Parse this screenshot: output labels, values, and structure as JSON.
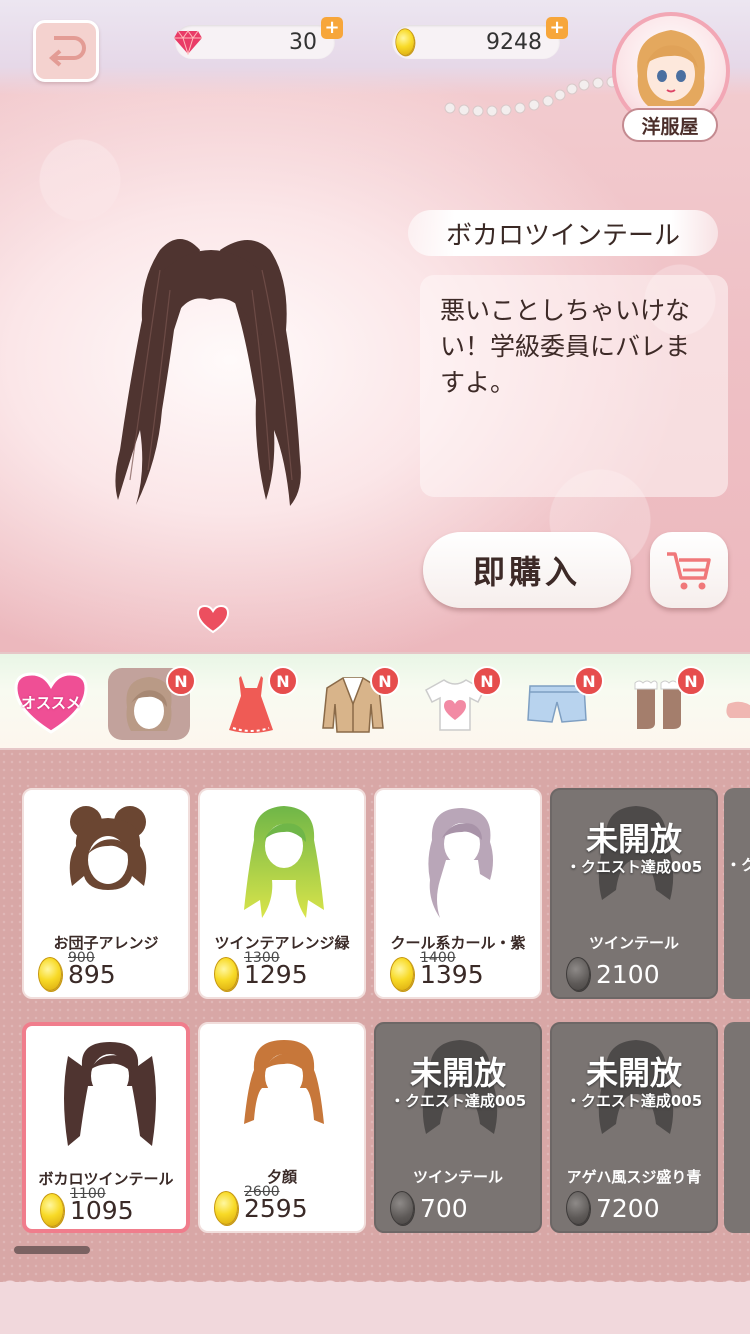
{
  "header": {
    "gems": "30",
    "coins": "9248",
    "shop_label": "洋服屋"
  },
  "preview": {
    "item_name": "ボカロツインテール",
    "description": "悪いことしちゃいけない！学級委員にバレますよ。",
    "buy_now_label": "即購入"
  },
  "categories": {
    "osusume_label": "オススメ",
    "badge": "N"
  },
  "items": [
    {
      "name": "お団子アレンジ",
      "old_price": "900",
      "price": "895",
      "locked": false,
      "hair_color": "#6b4632"
    },
    {
      "name": "ツインテアレンジ緑",
      "old_price": "1300",
      "price": "1295",
      "locked": false,
      "hair_color": "#7cc44a"
    },
    {
      "name": "クール系カール・紫",
      "old_price": "1400",
      "price": "1395",
      "locked": false,
      "hair_color": "#b9a6b8"
    },
    {
      "name": "ツインテール",
      "price": "2100",
      "locked": true,
      "lock_title": "未開放",
      "lock_sub": "・クエスト達成005"
    },
    {
      "name": "ボカロツインテール",
      "old_price": "1100",
      "price": "1095",
      "locked": false,
      "selected": true,
      "hair_color": "#4f3430"
    },
    {
      "name": "夕顔",
      "old_price": "2600",
      "price": "2595",
      "locked": false,
      "hair_color": "#c7773a"
    },
    {
      "name": "ツインテール",
      "price": "700",
      "locked": true,
      "lock_title": "未開放",
      "lock_sub": "・クエスト達成005"
    },
    {
      "name": "アゲハ風スジ盛り青",
      "price": "7200",
      "locked": true,
      "lock_title": "未開放",
      "lock_sub": "・クエスト達成005"
    }
  ],
  "peek": {
    "lock_sub": "・ク"
  },
  "colors": {
    "accent_pink": "#f07d8c",
    "badge_red": "#e64d4d",
    "coin_gold": "#f8da27"
  }
}
